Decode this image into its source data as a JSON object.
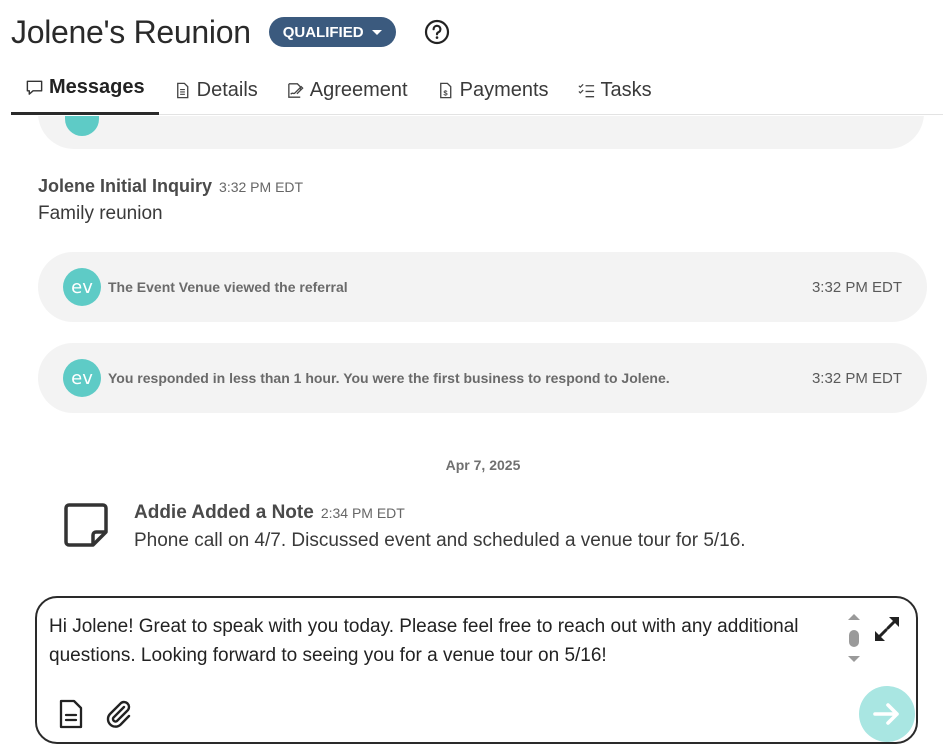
{
  "header": {
    "title": "Jolene's Reunion",
    "status": "QUALIFIED"
  },
  "tabs": [
    {
      "label": "Messages",
      "icon": "chat-bubble-icon",
      "active": true
    },
    {
      "label": "Details",
      "icon": "document-icon",
      "active": false
    },
    {
      "label": "Agreement",
      "icon": "signature-icon",
      "active": false
    },
    {
      "label": "Payments",
      "icon": "invoice-dollar-icon",
      "active": false
    },
    {
      "label": "Tasks",
      "icon": "checklist-icon",
      "active": false
    }
  ],
  "feed": {
    "inquiry": {
      "title": "Jolene Initial Inquiry",
      "time": "3:32 PM EDT",
      "body": "Family reunion"
    },
    "system_events": [
      {
        "avatar": "ev",
        "text": "The Event Venue viewed the referral",
        "time": "3:32 PM EDT"
      },
      {
        "avatar": "ev",
        "text": "You responded in less than 1 hour. You were the first business to respond to Jolene.",
        "time": "3:32 PM EDT"
      }
    ],
    "date_separator": "Apr 7, 2025",
    "note": {
      "title": "Addie Added a Note",
      "time": "2:34 PM EDT",
      "body": "Phone call on 4/7. Discussed event and scheduled a venue tour for 5/16."
    }
  },
  "composer": {
    "text": "Hi Jolene! Great to speak with you today. Please feel free to reach out with any additional questions. Looking forward to seeing you for a venue tour on 5/16!"
  },
  "colors": {
    "badge": "#3b5a7e",
    "accent_teal": "#5ecbc6",
    "send_button": "#a9e6e2",
    "pill_bg": "#f3f3f3"
  }
}
